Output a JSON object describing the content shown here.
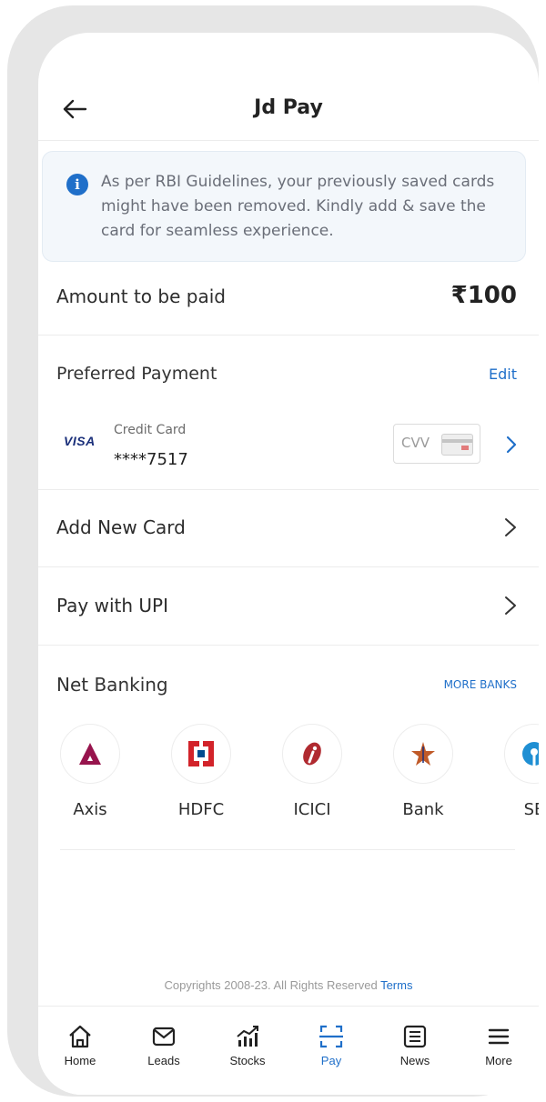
{
  "header": {
    "title": "Jd Pay"
  },
  "notice": {
    "text": "As per RBI Guidelines, your previously saved cards might have been removed. Kindly add & save the card for seamless experience.",
    "icon": "info-icon"
  },
  "amount": {
    "label": "Amount to be paid",
    "value": "₹100"
  },
  "preferred": {
    "label": "Preferred Payment",
    "edit_label": "Edit",
    "card": {
      "brand": "VISA",
      "type": "Credit Card",
      "number": "****7517",
      "cvv_placeholder": "CVV"
    }
  },
  "options": {
    "add_card": "Add New Card",
    "upi": "Pay with UPI"
  },
  "net_banking": {
    "label": "Net Banking",
    "more_label": "MORE BANKS",
    "banks": [
      {
        "name": "Axis",
        "color": "#97144d"
      },
      {
        "name": "HDFC",
        "color": "#d2232a"
      },
      {
        "name": "ICICI",
        "color": "#b02a30"
      },
      {
        "name": "Bank",
        "color": "#c05a28"
      },
      {
        "name": "SE",
        "color": "#1f8fd3"
      }
    ]
  },
  "footer": {
    "copyright": "Copyrights 2008-23. All Rights Reserved",
    "terms": "Terms"
  },
  "nav": {
    "items": [
      {
        "label": "Home",
        "icon": "home-icon"
      },
      {
        "label": "Leads",
        "icon": "mail-icon"
      },
      {
        "label": "Stocks",
        "icon": "stocks-icon"
      },
      {
        "label": "Pay",
        "icon": "scan-pay-icon",
        "active": true
      },
      {
        "label": "News",
        "icon": "news-icon"
      },
      {
        "label": "More",
        "icon": "menu-icon"
      }
    ]
  },
  "colors": {
    "accent": "#1f6fc9",
    "info_bg": "#f3f7fb"
  }
}
